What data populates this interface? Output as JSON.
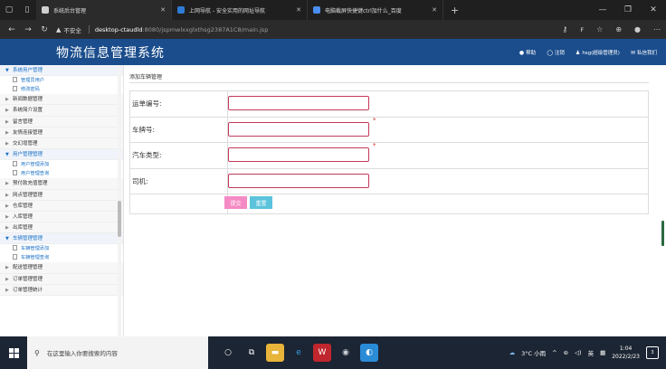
{
  "browser": {
    "tabs": [
      {
        "label": "系统后台管理",
        "color": "#cfcfcf"
      },
      {
        "label": "上网导航 - 安全实用的网址导航",
        "color": "#2d7bd6"
      },
      {
        "label": "电脑截屏快捷键ctrl加什么_百度",
        "color": "#4a8ef0"
      }
    ],
    "security_text": "不安全",
    "url_host": "desktop-ctaudld",
    "url_path": ":8080/jspmwlxxglxthsg2387A1C8/main.jsp",
    "new_tab": "+"
  },
  "app": {
    "title": "物流信息管理系统",
    "header_links": [
      {
        "icon": "●",
        "label": "帮助"
      },
      {
        "icon": "◯",
        "label": "注销"
      },
      {
        "icon": "♟",
        "label": "hsg(超级管理员)"
      },
      {
        "icon": "✉",
        "label": "私信我们"
      }
    ]
  },
  "sidebar": {
    "groups": [
      {
        "label": "系统用户管理",
        "open": true,
        "items": [
          "管理员用户",
          "修改密码"
        ]
      },
      {
        "label": "新闻数据管理",
        "open": false,
        "items": []
      },
      {
        "label": "系统简介设置",
        "open": false,
        "items": []
      },
      {
        "label": "留言管理",
        "open": false,
        "items": []
      },
      {
        "label": "友情连接管理",
        "open": false,
        "items": []
      },
      {
        "label": "交幻增管理",
        "open": false,
        "items": []
      },
      {
        "label": "用户管理管理",
        "open": true,
        "items": [
          "用户管理添加",
          "用户管理查询"
        ]
      },
      {
        "label": "预付款充值管理",
        "open": false,
        "items": []
      },
      {
        "label": "网点管理管理",
        "open": false,
        "items": []
      },
      {
        "label": "仓库管理",
        "open": false,
        "items": []
      },
      {
        "label": "入库管理",
        "open": false,
        "items": []
      },
      {
        "label": "出库管理",
        "open": false,
        "items": []
      },
      {
        "label": "车辆管理管理",
        "open": true,
        "items": [
          "车辆管理添加",
          "车辆管理查询"
        ]
      },
      {
        "label": "配送管理管理",
        "open": false,
        "items": []
      },
      {
        "label": "订单管理管理",
        "open": false,
        "items": []
      },
      {
        "label": "订单管理统计",
        "open": false,
        "items": []
      }
    ]
  },
  "form": {
    "breadcrumb": "添加车辆管理",
    "fields": [
      {
        "label": "运单编号:",
        "value": "",
        "required": false
      },
      {
        "label": "车牌号:",
        "value": "",
        "required": true
      },
      {
        "label": "汽车类型:",
        "value": "",
        "required": true
      },
      {
        "label": "司机:",
        "value": "",
        "required": false
      }
    ],
    "submit_label": "提交",
    "reset_label": "重置"
  },
  "taskbar": {
    "search_placeholder": "在这里输入你要搜索的内容",
    "weather": "3°C 小雨",
    "ime": "英",
    "time": "1:04",
    "date": "2022/2/23",
    "notif_count": "3"
  }
}
